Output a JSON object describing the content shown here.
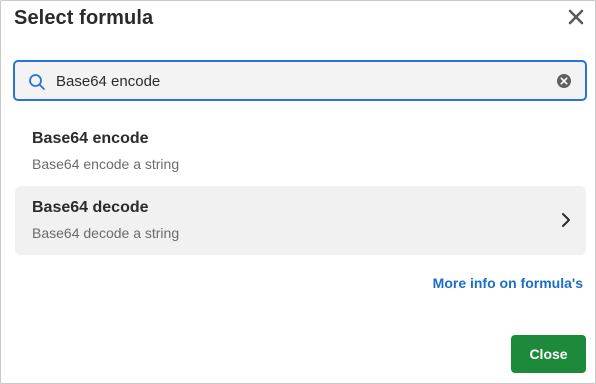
{
  "dialog": {
    "title": "Select formula",
    "close_icon": "close-icon"
  },
  "search": {
    "icon": "search-icon",
    "value": "Base64 encode",
    "clear_icon": "clear-icon"
  },
  "results": [
    {
      "name": "Base64 encode",
      "description": "Base64 encode a string",
      "highlighted": false
    },
    {
      "name": "Base64 decode",
      "description": "Base64 decode a string",
      "highlighted": true,
      "icon": "chevron-right-icon"
    }
  ],
  "footer": {
    "more_info_link": "More info on formula's",
    "close_label": "Close"
  },
  "colors": {
    "accent_blue": "#2a73d6",
    "link_blue": "#1a6fc9",
    "close_green": "#1d8a3b",
    "highlight_bg": "#f1f1f1"
  }
}
